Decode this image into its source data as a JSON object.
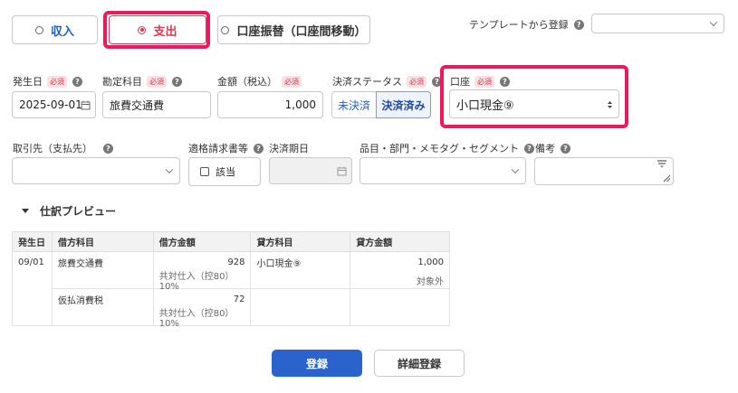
{
  "type_tabs": {
    "income": "収入",
    "expense": "支出",
    "transfer": "口座振替（口座間移動）"
  },
  "template": {
    "label": "テンプレートから登録",
    "value": ""
  },
  "required_badge": "必須",
  "help_glyph": "?",
  "fields": {
    "date": {
      "label": "発生日",
      "value": "2025-09-01"
    },
    "account_item": {
      "label": "勘定科目",
      "value": "旅費交通費"
    },
    "amount": {
      "label": "金額（税込）",
      "value": "1,000"
    },
    "settlement_status": {
      "label": "決済ステータス",
      "options": [
        "未決済",
        "決済済み"
      ],
      "selected": "決済済み"
    },
    "wallet": {
      "label": "口座",
      "value": "小口現金⑨"
    },
    "partner": {
      "label": "取引先（支払先）",
      "value": ""
    },
    "qualified_invoice": {
      "label": "適格請求書等",
      "checkbox_label": "該当"
    },
    "settlement_due": {
      "label": "決済期日",
      "value": ""
    },
    "tags": {
      "label": "品目・部門・メモタグ・セグメント",
      "value": ""
    },
    "remarks": {
      "label": "備考",
      "value": ""
    }
  },
  "preview": {
    "title": "仕訳プレビュー",
    "headers": [
      "発生日",
      "借方科目",
      "借方金額",
      "貸方科目",
      "貸方金額"
    ],
    "rows": [
      {
        "date": "09/01",
        "debit_account": "旅費交通費",
        "debit_amount": "928",
        "debit_tax": "共対仕入（控80）10%",
        "credit_account": "小口現金⑨",
        "credit_amount": "1,000",
        "credit_tax": "対象外"
      },
      {
        "date": "",
        "debit_account": "仮払消費税",
        "debit_amount": "72",
        "debit_tax": "共対仕入（控80）10%",
        "credit_account": "",
        "credit_amount": "",
        "credit_tax": ""
      }
    ]
  },
  "actions": {
    "submit": "登録",
    "detail": "詳細登録"
  },
  "colors": {
    "accent_red": "#e0354d",
    "highlight": "#f0185a",
    "link_blue": "#1f5ec8",
    "primary_button": "#2a63cc"
  }
}
